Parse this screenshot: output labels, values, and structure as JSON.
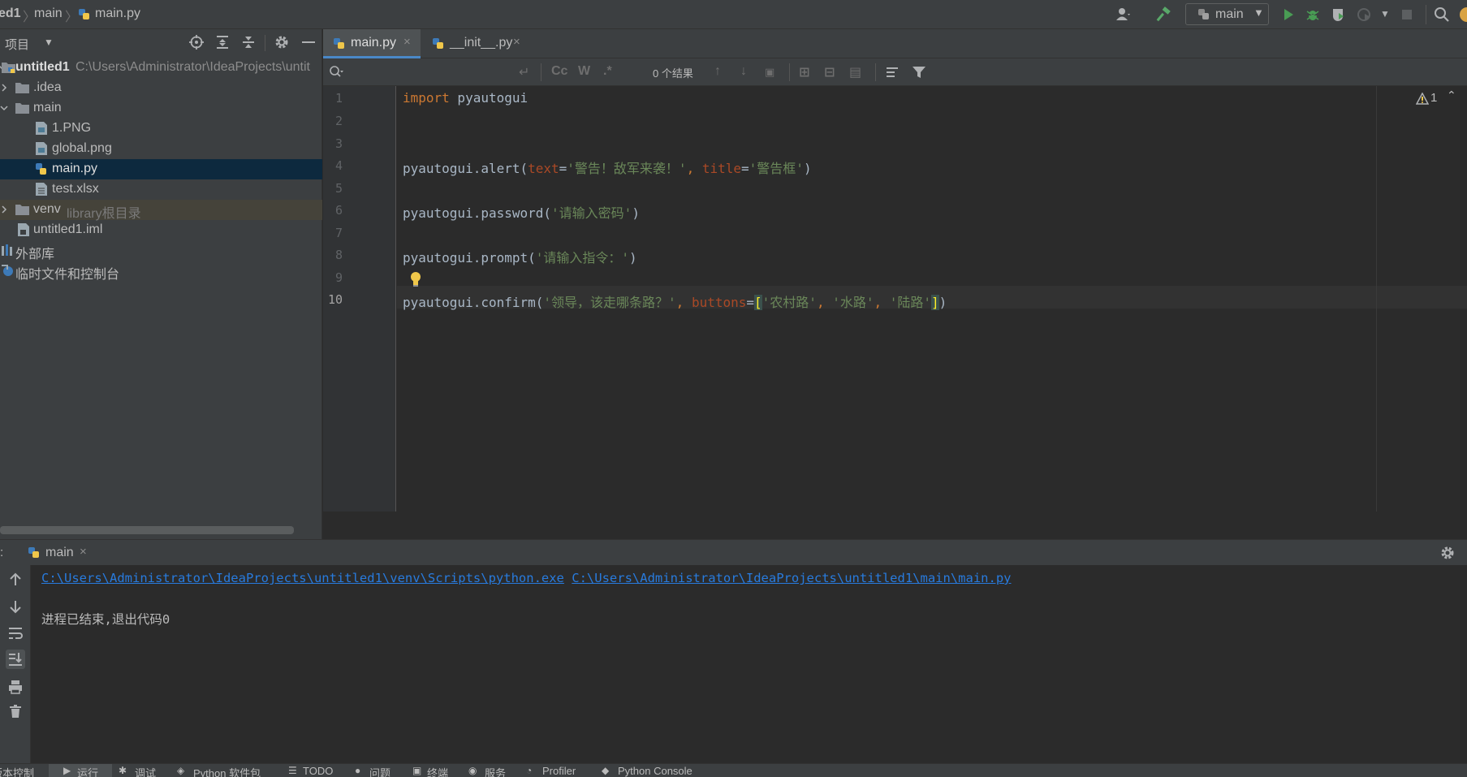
{
  "breadcrumb": {
    "project": "ed1",
    "folder": "main",
    "file": "main.py"
  },
  "toolbar": {
    "run_config": "main"
  },
  "project_panel": {
    "title": "项目",
    "tree": [
      {
        "label": "untitled1",
        "path": "C:\\Users\\Administrator\\IdeaProjects\\untit"
      },
      {
        "label": ".idea"
      },
      {
        "label": "main"
      },
      {
        "label": "1.PNG"
      },
      {
        "label": "global.png"
      },
      {
        "label": "main.py"
      },
      {
        "label": "test.xlsx"
      },
      {
        "label": "venv",
        "hint": "library根目录"
      },
      {
        "label": "untitled1.iml"
      },
      {
        "label": "外部库"
      },
      {
        "label": "临时文件和控制台"
      }
    ]
  },
  "tabs": [
    {
      "label": "main.py",
      "close": "×"
    },
    {
      "label": "__init__.py",
      "close": "×"
    }
  ],
  "find": {
    "results": "0 个结果",
    "cc": "Cc",
    "w": "W",
    "regex": ".*"
  },
  "editor": {
    "line_numbers": [
      "1",
      "2",
      "3",
      "4",
      "5",
      "6",
      "7",
      "8",
      "9",
      "10"
    ],
    "warnings": "1",
    "lines": {
      "l1_kw": "import",
      "l1_rest": " pyautogui",
      "l4_a": "pyautogui.alert(",
      "l4_p1": "text",
      "l4_eq1": "=",
      "l4_s1": "'警告！敌军来袭！'",
      "l4_c": ", ",
      "l4_p2": "title",
      "l4_eq2": "=",
      "l4_s2": "'警告框'",
      "l4_end": ")",
      "l6_a": "pyautogui.password(",
      "l6_s": "'请输入密码'",
      "l6_end": ")",
      "l8_a": "pyautogui.prompt(",
      "l8_s": "'请输入指令：'",
      "l8_end": ")",
      "l10_a": "pyautogui.confirm(",
      "l10_s1": "'领导，该走哪条路？'",
      "l10_c1": ", ",
      "l10_p": "buttons",
      "l10_eq": "=",
      "l10_b1": "[",
      "l10_s2": "'农村路'",
      "l10_c2": ", ",
      "l10_s3": "'水路'",
      "l10_c3": ", ",
      "l10_s4": "'陆路'",
      "l10_b2": "]",
      "l10_end": ")"
    }
  },
  "run": {
    "left_label": ":",
    "tab_label": "main",
    "tab_close": "×",
    "python_path": "C:\\Users\\Administrator\\IdeaProjects\\untitled1\\venv\\Scripts\\python.exe",
    "script_path": "C:\\Users\\Administrator\\IdeaProjects\\untitled1\\main\\main.py",
    "exit_message": "进程已结束,退出代码0"
  },
  "bottom_bar": [
    "版本控制",
    "运行",
    "调试",
    "Python 软件包",
    "TODO",
    "问题",
    "终端",
    "服务",
    "Profiler",
    "Python Console"
  ]
}
